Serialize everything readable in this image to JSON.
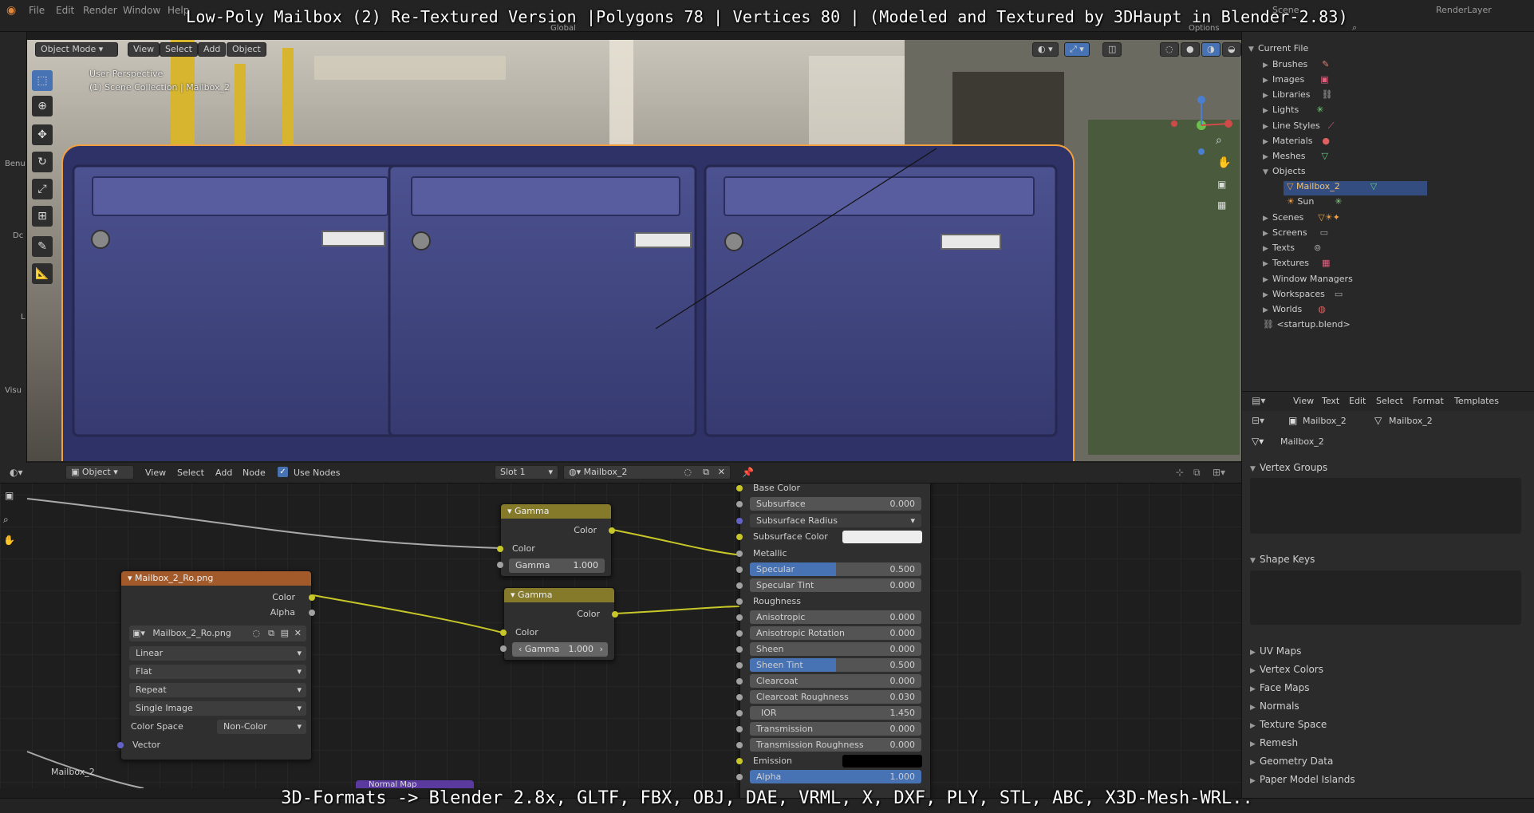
{
  "overlay": {
    "title": "Low-Poly Mailbox (2) Re-Textured Version |Polygons 78 | Vertices 80 | (Modeled and Textured by 3DHaupt in Blender-2.83)",
    "bottom": "3D-Formats -> Blender 2.8x, GLTF, FBX, OBJ, DAE, VRML, X, DXF, PLY, STL, ABC, X3D-Mesh-WRL.."
  },
  "topmenu": [
    "File",
    "Edit",
    "Render",
    "Window",
    "Help"
  ],
  "topbar_right": {
    "scene": "Scene",
    "renderlayer": "RenderLayer",
    "orientation": "Global",
    "options": "Options"
  },
  "viewport": {
    "mode": "Object Mode",
    "menus": [
      "View",
      "Select",
      "Add",
      "Object"
    ],
    "info_line1": "User Perspective",
    "info_line2": "(1) Scene Collection | Mailbox_2",
    "left_labels": [
      "Benu",
      "Dc",
      "L",
      "Visu"
    ]
  },
  "outliner": {
    "root": "Current File",
    "items": [
      "Brushes",
      "Images",
      "Libraries",
      "Lights",
      "Line Styles",
      "Materials",
      "Meshes",
      "Objects"
    ],
    "objects": [
      "Mailbox_2",
      "Sun"
    ],
    "items2": [
      "Scenes",
      "Screens",
      "Texts",
      "Textures",
      "Window Managers",
      "Workspaces",
      "Worlds"
    ],
    "startup": "<startup.blend>",
    "icon_colors": {
      "brushes": "#e08080",
      "images": "#e06080",
      "lights": "#80d080",
      "materials": "#e06060",
      "meshes": "#60d080",
      "textures": "#e06080",
      "worlds": "#e06060"
    }
  },
  "properties": {
    "menus": [
      "View",
      "Text",
      "Edit",
      "Select",
      "Format",
      "Templates"
    ],
    "object_name": "Mailbox_2",
    "mesh_name": "Mailbox_2",
    "data_name": "Mailbox_2",
    "sections": [
      "Vertex Groups",
      "Shape Keys",
      "UV Maps",
      "Vertex Colors",
      "Face Maps",
      "Normals",
      "Texture Space",
      "Remesh",
      "Geometry Data",
      "Paper Model Islands"
    ]
  },
  "node_editor": {
    "type": "Object",
    "menus": [
      "View",
      "Select",
      "Add",
      "Node"
    ],
    "use_nodes": "Use Nodes",
    "slot": "Slot 1",
    "material": "Mailbox_2",
    "corner_label": "Mailbox_2",
    "normal_map": "Normal Map",
    "image_node": {
      "title": "Mailbox_2_Ro.png",
      "out_color": "Color",
      "out_alpha": "Alpha",
      "image_name": "Mailbox_2_Ro.png",
      "interpolation": "Linear",
      "projection": "Flat",
      "extension": "Repeat",
      "source": "Single Image",
      "color_space_label": "Color Space",
      "color_space": "Non-Color",
      "vector": "Vector"
    },
    "gamma1": {
      "title": "Gamma",
      "out": "Color",
      "in": "Color",
      "gamma_label": "Gamma",
      "gamma": "1.000"
    },
    "gamma2": {
      "title": "Gamma",
      "out": "Color",
      "in": "Color",
      "gamma_label": "Gamma",
      "gamma": "1.000"
    },
    "bsdf": {
      "base_color": "Base Color",
      "subsurface": {
        "label": "Subsurface",
        "value": "0.000"
      },
      "subsurface_radius": "Subsurface Radius",
      "subsurface_color": "Subsurface Color",
      "metallic": "Metallic",
      "specular": {
        "label": "Specular",
        "value": "0.500",
        "fill": 0.5
      },
      "specular_tint": {
        "label": "Specular Tint",
        "value": "0.000"
      },
      "roughness": "Roughness",
      "anisotropic": {
        "label": "Anisotropic",
        "value": "0.000"
      },
      "anisotropic_rotation": {
        "label": "Anisotropic Rotation",
        "value": "0.000"
      },
      "sheen": {
        "label": "Sheen",
        "value": "0.000"
      },
      "sheen_tint": {
        "label": "Sheen Tint",
        "value": "0.500",
        "fill": 0.5
      },
      "clearcoat": {
        "label": "Clearcoat",
        "value": "0.000"
      },
      "clearcoat_roughness": {
        "label": "Clearcoat Roughness",
        "value": "0.030"
      },
      "ior": {
        "label": "IOR",
        "value": "1.450"
      },
      "transmission": {
        "label": "Transmission",
        "value": "0.000"
      },
      "transmission_roughness": {
        "label": "Transmission Roughness",
        "value": "0.000"
      },
      "emission": "Emission",
      "alpha": {
        "label": "Alpha",
        "value": "1.000",
        "fill": 1.0
      }
    }
  },
  "colors": {
    "accent": "#4772b3",
    "image_node_head": "#a35a2a",
    "gamma_head": "#857a2a",
    "socket_yellow": "#c7c729",
    "socket_gray": "#a1a1a1",
    "socket_purple": "#6363c7",
    "selection": "#f0a040",
    "mailbox": "#3b3f7a"
  }
}
